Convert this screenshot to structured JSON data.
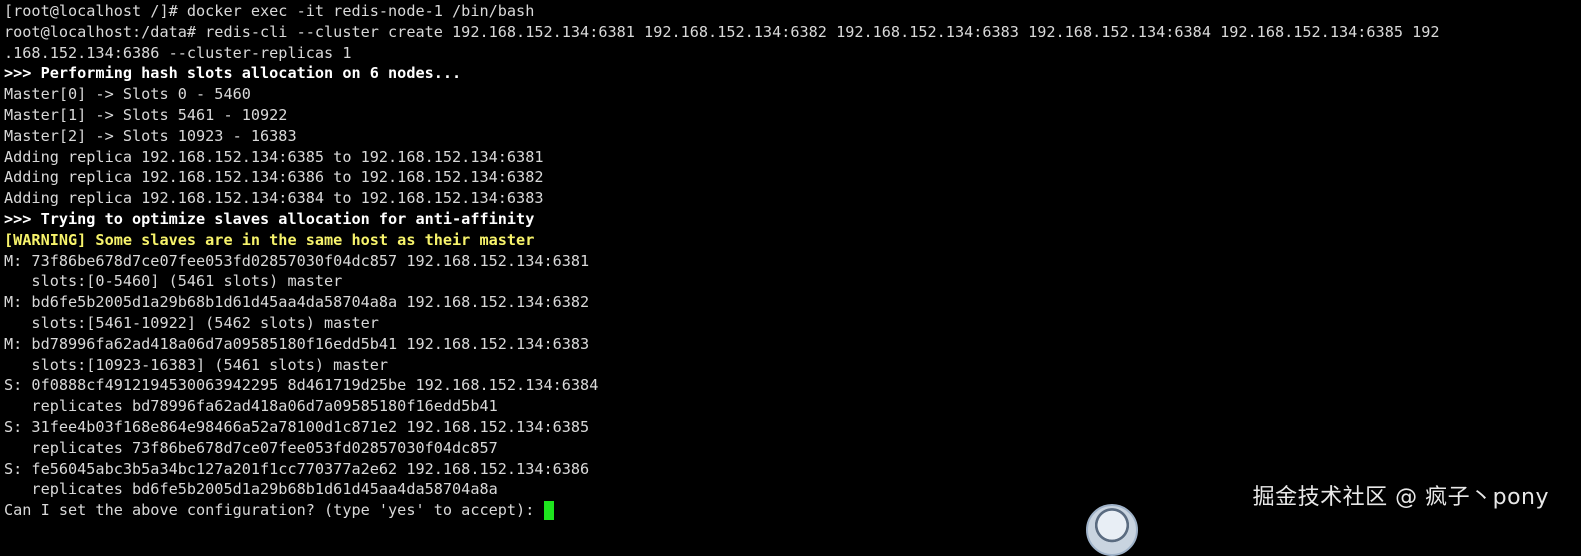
{
  "terminal": {
    "lines": [
      {
        "text": "[root@localhost /]# docker exec -it redis-node-1 /bin/bash",
        "style": "normal"
      },
      {
        "text": "root@localhost:/data# redis-cli --cluster create 192.168.152.134:6381 192.168.152.134:6382 192.168.152.134:6383 192.168.152.134:6384 192.168.152.134:6385 192",
        "style": "normal"
      },
      {
        "text": ".168.152.134:6386 --cluster-replicas 1",
        "style": "normal"
      },
      {
        "text": ">>> Performing hash slots allocation on 6 nodes...",
        "style": "bold"
      },
      {
        "text": "Master[0] -> Slots 0 - 5460",
        "style": "normal"
      },
      {
        "text": "Master[1] -> Slots 5461 - 10922",
        "style": "normal"
      },
      {
        "text": "Master[2] -> Slots 10923 - 16383",
        "style": "normal"
      },
      {
        "text": "Adding replica 192.168.152.134:6385 to 192.168.152.134:6381",
        "style": "normal"
      },
      {
        "text": "Adding replica 192.168.152.134:6386 to 192.168.152.134:6382",
        "style": "normal"
      },
      {
        "text": "Adding replica 192.168.152.134:6384 to 192.168.152.134:6383",
        "style": "normal"
      },
      {
        "text": ">>> Trying to optimize slaves allocation for anti-affinity",
        "style": "bold"
      },
      {
        "text": "[WARNING] Some slaves are in the same host as their master",
        "style": "warn"
      },
      {
        "text": "M: 73f86be678d7ce07fee053fd02857030f04dc857 192.168.152.134:6381",
        "style": "normal"
      },
      {
        "text": "   slots:[0-5460] (5461 slots) master",
        "style": "normal"
      },
      {
        "text": "M: bd6fe5b2005d1a29b68b1d61d45aa4da58704a8a 192.168.152.134:6382",
        "style": "normal"
      },
      {
        "text": "   slots:[5461-10922] (5462 slots) master",
        "style": "normal"
      },
      {
        "text": "M: bd78996fa62ad418a06d7a09585180f16edd5b41 192.168.152.134:6383",
        "style": "normal"
      },
      {
        "text": "   slots:[10923-16383] (5461 slots) master",
        "style": "normal"
      },
      {
        "text": "S: 0f0888cf4912194530063942295 8d461719d25be 192.168.152.134:6384",
        "style": "normal"
      },
      {
        "text": "   replicates bd78996fa62ad418a06d7a09585180f16edd5b41",
        "style": "normal"
      },
      {
        "text": "S: 31fee4b03f168e864e98466a52a78100d1c871e2 192.168.152.134:6385",
        "style": "normal"
      },
      {
        "text": "   replicates 73f86be678d7ce07fee053fd02857030f04dc857",
        "style": "normal"
      },
      {
        "text": "S: fe56045abc3b5a34bc127a201f1cc770377a2e62 192.168.152.134:6386",
        "style": "normal"
      },
      {
        "text": "   replicates bd6fe5b2005d1a29b68b1d61d45aa4da58704a8a",
        "style": "normal"
      }
    ],
    "prompt": "Can I set the above configuration? (type 'yes' to accept): ",
    "input_value": ""
  },
  "watermark": "掘金技术社区 @ 疯子丶pony",
  "colors": {
    "background": "#000000",
    "text": "#d9d9d9",
    "bold_text": "#ffffff",
    "warning": "#f7f36b",
    "cursor": "#1ee51e"
  }
}
